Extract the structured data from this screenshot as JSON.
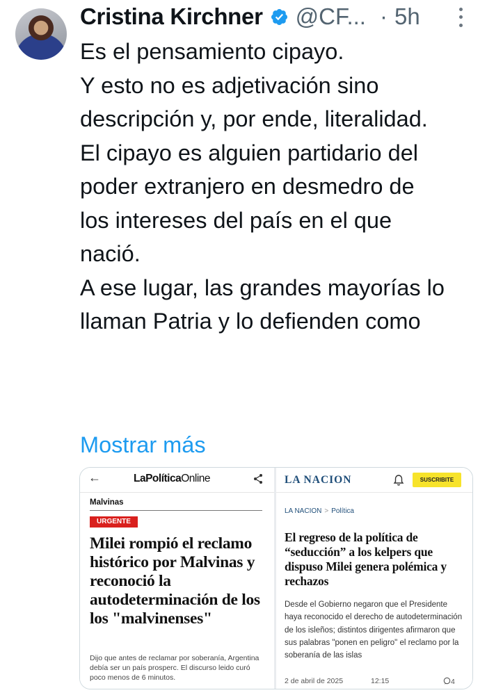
{
  "tweet": {
    "author_name": "Cristina Kirchner",
    "handle": "@CF...",
    "separator": "·",
    "time": "5h",
    "paragraphs": [
      [
        "Es el pensamiento cipayo."
      ],
      [
        "Y esto no es adjetivación sino",
        "descripción y, por ende, literalidad."
      ],
      [
        "El cipayo es alguien partidario del",
        "poder extranjero en desmedro de",
        "los intereses del país en el que",
        "nació."
      ],
      [
        "A ese lugar, las grandes mayorías lo",
        "llaman Patria y lo defienden como"
      ]
    ],
    "show_more": "Mostrar más"
  },
  "icons": {
    "verified": "verified-badge-icon",
    "more": "more-vertical-icon",
    "back": "arrow-left-icon",
    "share": "share-icon",
    "bell": "bell-icon",
    "comments": "comment-icon"
  },
  "colors": {
    "link": "#1d9bf0",
    "verified": "#1d9bf0",
    "urgent": "#d9201d",
    "lanacion_brand": "#1f4e79",
    "subscribe": "#f7e32b"
  },
  "media": {
    "left": {
      "back_glyph": "←",
      "logo_bold": "LaPolítica",
      "logo_regular": "Online",
      "section": "Malvinas",
      "tag": "URGENTE",
      "headline": "Milei rompió el reclamo histórico por Malvinas y reconoció la autodeterminación de los los \"malvinenses\"",
      "lead": "Dijo que antes de reclamar por soberanía, Argentina debía ser un país prosperc. El discurso leido curó poco menos de 6 minutos."
    },
    "right": {
      "logo": "LA NACION",
      "subscribe": "SUSCRIBITE",
      "breadcrumb_home": "LA NACION",
      "breadcrumb_sep": ">",
      "breadcrumb_section": "Política",
      "headline": "El regreso de la política de “seducción” a los kelpers que dispuso Milei genera polémica y rechazos",
      "lead": "Desde el Gobierno negaron que el Presidente haya reconocido el derecho de autodeterminación de los isleños; distintos dirigentes afirmaron que sus palabras \"ponen en peligro\" el reclamo por la soberanía de las islas",
      "date": "2 de abril de 2025",
      "hour": "12:15",
      "comments": "4"
    }
  }
}
